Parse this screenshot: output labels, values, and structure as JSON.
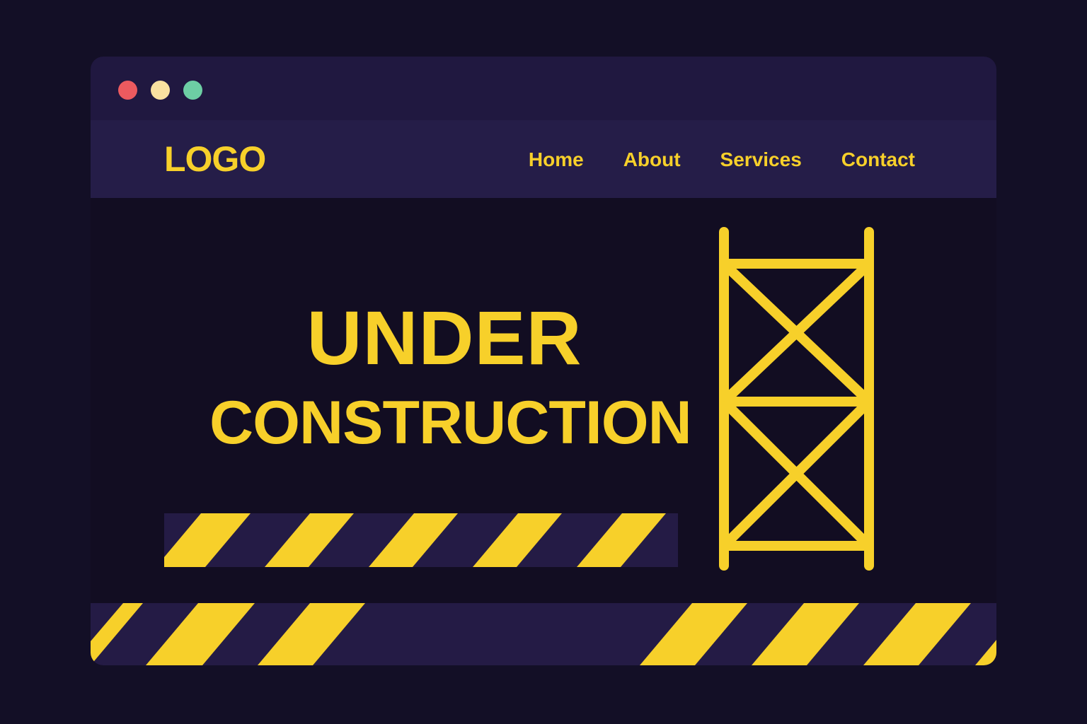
{
  "window": {
    "controls": {
      "close_color": "#ec5a5f",
      "minimize_color": "#f9e1a0",
      "maximize_color": "#6dcea4"
    }
  },
  "header": {
    "logo_text": "LOGO",
    "nav": [
      {
        "label": "Home"
      },
      {
        "label": "About"
      },
      {
        "label": "Services"
      },
      {
        "label": "Contact"
      }
    ]
  },
  "hero": {
    "title_line1": "UNDER",
    "title_line2": "CONSTRUCTION"
  },
  "colors": {
    "page_background": "#130f26",
    "title_bar": "#201840",
    "nav_bar": "#251d48",
    "content_background": "#120d22",
    "accent_yellow": "#f7d02a",
    "stripe_dark": "#241b45"
  },
  "icons": {
    "hero_illustration": "scaffolding-icon",
    "decoration": "hazard-stripes"
  }
}
